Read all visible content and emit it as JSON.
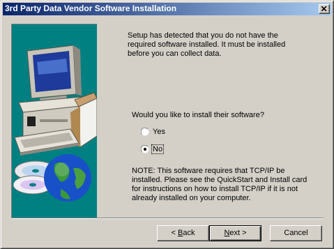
{
  "window": {
    "title": "3rd Party Data Vendor Software Installation"
  },
  "content": {
    "intro": "Setup has detected that you do not have the required software installed. It must be installed before you can collect data.",
    "question": "Would you like to install their software?",
    "options": [
      {
        "label": "Yes",
        "selected": false
      },
      {
        "label": "No",
        "selected": true
      }
    ],
    "note": "NOTE: This software requires that TCP/IP be installed. Please see the QuickStart and Install card for instructions on how to install TCP/IP if it is not already installed on your computer."
  },
  "buttons": {
    "back": {
      "mnemonic": "B",
      "rest": "ack",
      "prefix": "< "
    },
    "next": {
      "mnemonic": "N",
      "rest": "ext",
      "suffix": " >"
    },
    "cancel": "Cancel"
  },
  "colors": {
    "title_start": "#0a246a",
    "title_end": "#a6caf0",
    "face": "#d4d0c8",
    "art_background": "#008080"
  }
}
